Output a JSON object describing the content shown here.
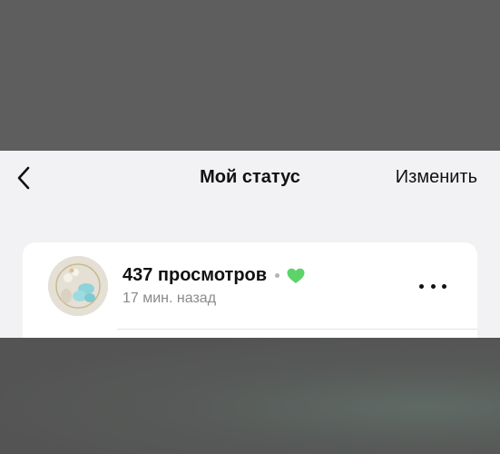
{
  "header": {
    "title": "Мой статус",
    "edit_label": "Изменить"
  },
  "status": {
    "views_label": "437 просмотров",
    "time_ago": "17 мин. назад",
    "reaction_color": "#5dd36a"
  },
  "icons": {
    "back": "chevron-left-icon",
    "reaction": "heart-icon",
    "more": "more-horizontal-icon"
  }
}
